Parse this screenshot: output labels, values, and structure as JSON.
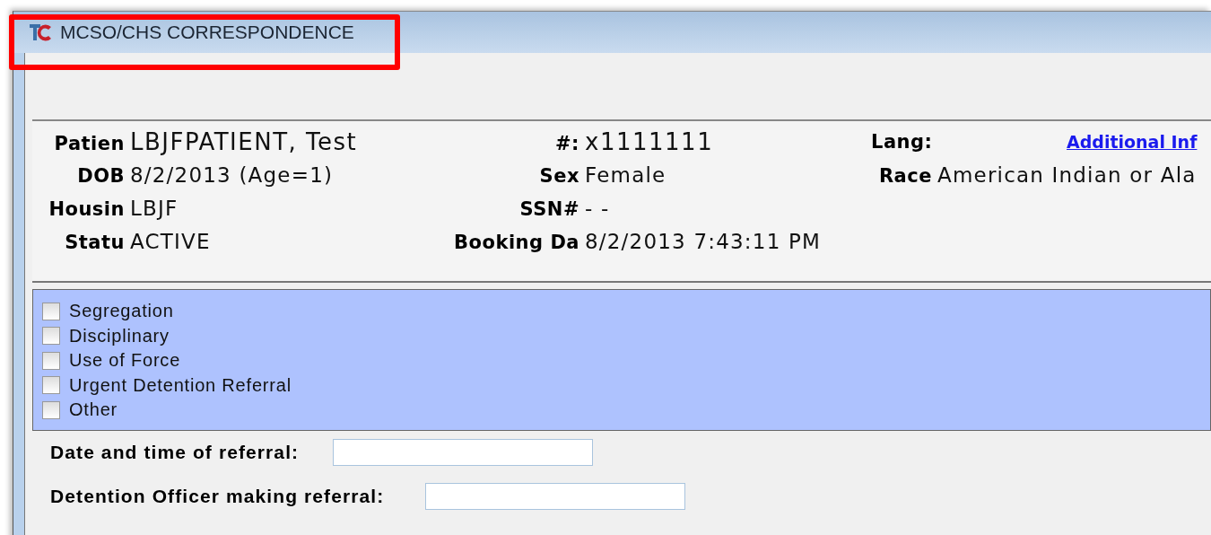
{
  "window": {
    "title": "MCSO/CHS CORRESPONDENCE"
  },
  "patient_rows": [
    [
      {
        "label": "Patien",
        "value": "LBJFPATIENT, Test",
        "kind": "large"
      },
      {
        "label": "#:",
        "value": "x1111111",
        "kind": "large"
      },
      {
        "label": "Lang:",
        "link": "Additional Inf",
        "kind": "link"
      }
    ],
    [
      {
        "label": "DOB",
        "value": "8/2/2013 (Age=1)",
        "kind": "plain"
      },
      {
        "label": "Sex",
        "value": "Female",
        "kind": "plain"
      },
      {
        "label": "Race",
        "value": "American Indian or Ala",
        "kind": "plain"
      }
    ],
    [
      {
        "label": "Housin",
        "value": "LBJF",
        "kind": "plain"
      },
      {
        "label": "SSN#",
        "value": "-  -",
        "kind": "plain"
      }
    ],
    [
      {
        "label": "Statu",
        "value": "ACTIVE",
        "kind": "plain"
      },
      {
        "label": "Booking Da",
        "value": "8/2/2013 7:43:11 PM",
        "kind": "plain"
      }
    ]
  ],
  "referral_types": [
    {
      "label": "Segregation",
      "checked": false
    },
    {
      "label": "Disciplinary",
      "checked": false
    },
    {
      "label": "Use of Force",
      "checked": false
    },
    {
      "label": "Urgent Detention Referral",
      "checked": false
    },
    {
      "label": "Other",
      "checked": false
    }
  ],
  "form_fields": [
    {
      "label": "Date and time of referral:"
    },
    {
      "label": "Detention Officer making referral:"
    }
  ]
}
